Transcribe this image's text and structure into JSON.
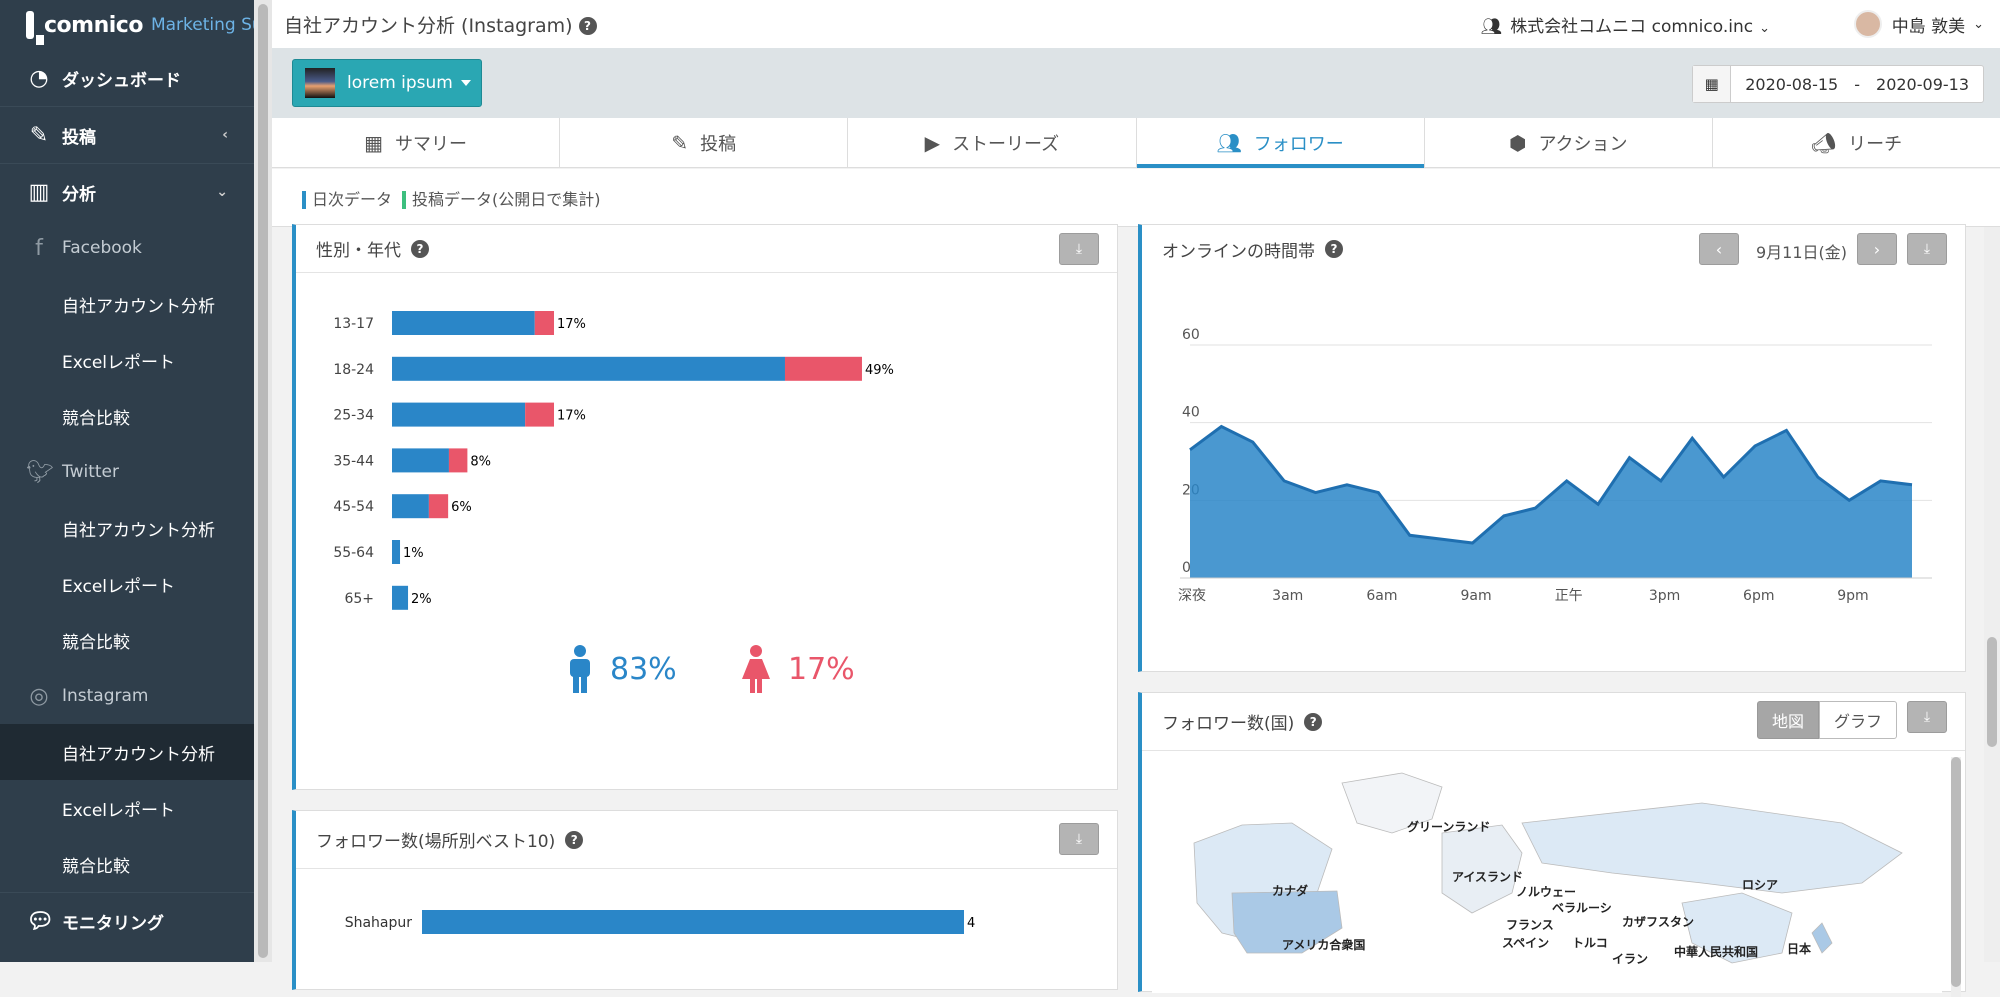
{
  "app": {
    "brand": "comnico",
    "suite": "Marketing Suite"
  },
  "sidebar": {
    "items": [
      {
        "label": "ダッシュボード",
        "icon": "gauge-icon"
      },
      {
        "label": "投稿",
        "icon": "pencil-icon"
      },
      {
        "label": "分析",
        "icon": "bar-chart-icon"
      },
      {
        "label": "Facebook",
        "icon": "facebook-icon"
      },
      {
        "label": "自社アカウント分析"
      },
      {
        "label": "Excelレポート"
      },
      {
        "label": "競合比較"
      },
      {
        "label": "Twitter",
        "icon": "twitter-icon"
      },
      {
        "label": "自社アカウント分析"
      },
      {
        "label": "Excelレポート"
      },
      {
        "label": "競合比較"
      },
      {
        "label": "Instagram",
        "icon": "instagram-icon"
      },
      {
        "label": "自社アカウント分析"
      },
      {
        "label": "Excelレポート"
      },
      {
        "label": "競合比較"
      },
      {
        "label": "モニタリング",
        "icon": "chat-icon"
      }
    ]
  },
  "header": {
    "title": "自社アカウント分析 (Instagram)",
    "org": "株式会社コムニコ comnico.inc",
    "user": "中島 敦美"
  },
  "account": {
    "name": "lorem ipsum"
  },
  "date_range": {
    "start": "2020-08-15",
    "separator": "-",
    "end": "2020-09-13"
  },
  "tabs": [
    {
      "label": "サマリー"
    },
    {
      "label": "投稿"
    },
    {
      "label": "ストーリーズ"
    },
    {
      "label": "フォロワー"
    },
    {
      "label": "アクション"
    },
    {
      "label": "リーチ"
    }
  ],
  "legend": {
    "daily": "日次データ",
    "posts": "投稿データ(公開日で集計)",
    "daily_color": "#2a8fc6",
    "posts_color": "#3cbf7e"
  },
  "panels": {
    "gender_age": {
      "title": "性別・年代",
      "male_pct": "83%",
      "female_pct": "17%"
    },
    "online": {
      "title": "オンラインの時間帯",
      "date": "9月11日(金)"
    },
    "location": {
      "title": "フォロワー数(場所別ベスト10)"
    },
    "country": {
      "title": "フォロワー数(国)",
      "map_btn": "地図",
      "graph_btn": "グラフ",
      "map_labels": [
        "グリーンランド",
        "カナダ",
        "アイスランド",
        "ノルウェー",
        "ベラルーシ",
        "ロシア",
        "カザフスタン",
        "フランス",
        "スペイン",
        "トルコ",
        "アメリカ合衆国",
        "イラン",
        "中華人民共和国",
        "日本"
      ]
    }
  },
  "chart_data": [
    {
      "type": "bar",
      "title": "性別・年代",
      "categories": [
        "13-17",
        "18-24",
        "25-34",
        "35-44",
        "45-54",
        "55-64",
        "65+"
      ],
      "series": [
        {
          "values": [
            17.8,
            49.0,
            16.6,
            7.1,
            4.6,
            1.0,
            2.0
          ],
          "color": "#2a86c8"
        },
        {
          "values": [
            2.4,
            9.6,
            3.6,
            2.3,
            2.4,
            0,
            0
          ],
          "color": "#e9566a"
        }
      ],
      "labels": [
        "17%",
        "49%",
        "17%",
        "8%",
        "6%",
        "1%",
        "2%"
      ],
      "stacked": true,
      "orientation": "horizontal"
    },
    {
      "type": "area",
      "title": "オンラインの時間帯",
      "x": [
        "深夜",
        "",
        "",
        "3am",
        "",
        "",
        "6am",
        "",
        "",
        "9am",
        "",
        "",
        "正午",
        "",
        "",
        "3pm",
        "",
        "",
        "6pm",
        "",
        "",
        "9pm",
        "",
        ""
      ],
      "xticks": [
        "深夜",
        "3am",
        "6am",
        "9am",
        "正午",
        "3pm",
        "6pm",
        "9pm"
      ],
      "values": [
        33,
        39,
        35,
        25,
        22,
        24,
        22,
        11,
        10,
        9,
        16,
        18,
        25,
        19,
        31,
        25,
        36,
        26,
        34,
        38,
        26,
        20,
        25,
        24
      ],
      "ylim": [
        0,
        60
      ],
      "yticks": [
        0,
        20,
        40,
        60
      ],
      "grid": true,
      "color": "#2a86c8"
    },
    {
      "type": "bar",
      "title": "フォロワー数(場所別ベスト10)",
      "categories": [
        "Shahapur"
      ],
      "values": [
        4
      ],
      "orientation": "horizontal",
      "color": "#2a86c8"
    }
  ]
}
